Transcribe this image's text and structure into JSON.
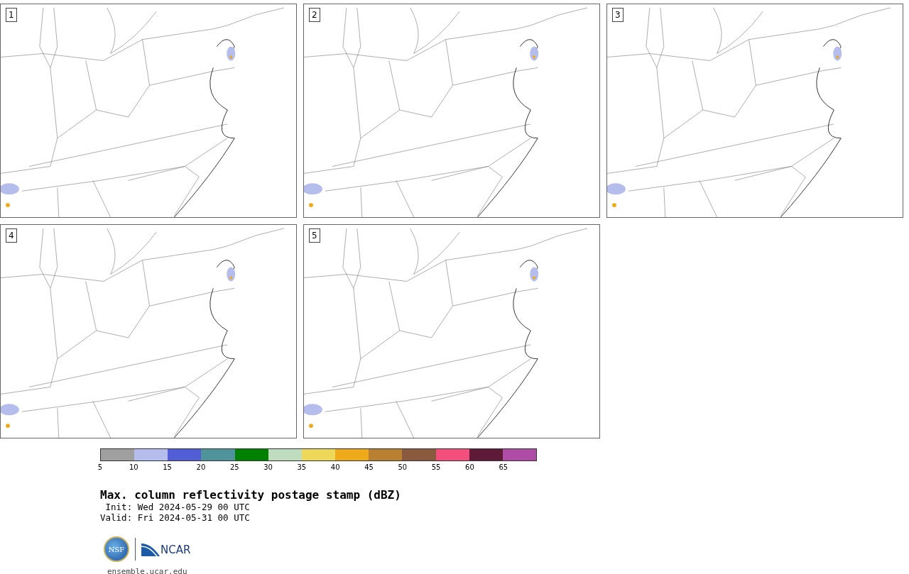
{
  "panels": [
    {
      "number": "1"
    },
    {
      "number": "2"
    },
    {
      "number": "3"
    },
    {
      "number": "4"
    },
    {
      "number": "5"
    }
  ],
  "colorbar": {
    "bins": [
      {
        "tick": "5",
        "color": "#a0a0a0"
      },
      {
        "tick": "10",
        "color": "#b4bdec"
      },
      {
        "tick": "15",
        "color": "#525ed6"
      },
      {
        "tick": "20",
        "color": "#4e949a"
      },
      {
        "tick": "25",
        "color": "#008000"
      },
      {
        "tick": "30",
        "color": "#bedcbe"
      },
      {
        "tick": "35",
        "color": "#eed85a"
      },
      {
        "tick": "40",
        "color": "#eeaa18"
      },
      {
        "tick": "45",
        "color": "#ba8032"
      },
      {
        "tick": "50",
        "color": "#8a5a3e"
      },
      {
        "tick": "55",
        "color": "#f44e7c"
      },
      {
        "tick": "60",
        "color": "#5e1a36"
      },
      {
        "tick": "65",
        "color": "#ae4ca6"
      }
    ]
  },
  "title": "Max. column reflectivity postage stamp (dBZ)",
  "init": " Init: Wed 2024-05-29 00 UTC",
  "valid": "Valid: Fri 2024-05-31 00 UTC",
  "logos": {
    "nsf": "NSF",
    "ncar": "NCAR"
  },
  "url": "ensemble.ucar.edu"
}
